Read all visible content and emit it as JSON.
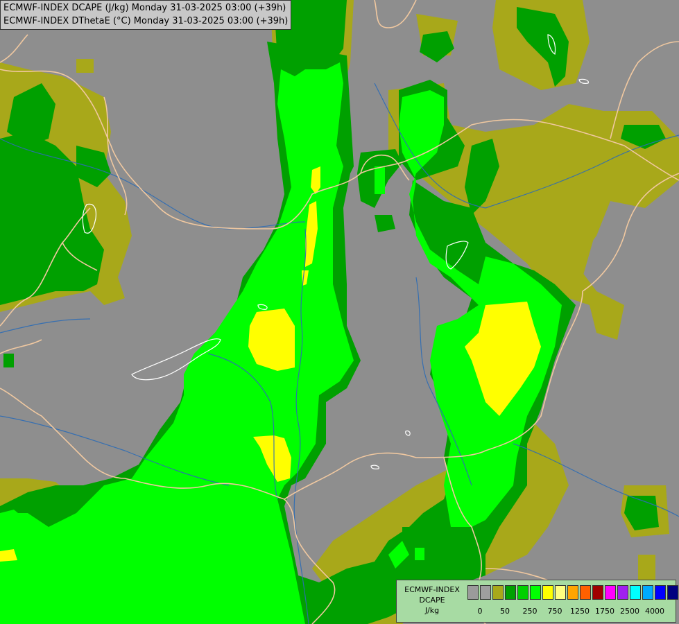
{
  "header": {
    "line1": "ECMWF-INDEX DCAPE (J/kg) Monday 31-03-2025 03:00 (+39h)",
    "line2": "ECMWF-INDEX DThetaE (°C) Monday 31-03-2025 03:00 (+39h)"
  },
  "legend": {
    "model": "ECMWF-INDEX",
    "parameter": "DCAPE",
    "unit": "J/kg",
    "colors": [
      "#9b9b9b",
      "#9f9f9f",
      "#a8a81a",
      "#00a000",
      "#00d000",
      "#00ff00",
      "#ffff00",
      "#ffff80",
      "#ffa500",
      "#ff6000",
      "#a00000",
      "#ff00ff",
      "#a020f0",
      "#00ffff",
      "#00aaff",
      "#0000ff",
      "#000080"
    ],
    "tick_labels": [
      "0",
      "50",
      "250",
      "750",
      "1250",
      "1750",
      "2500",
      "4000"
    ]
  },
  "colors": {
    "background": "#8e8e8e",
    "olive": "#a8a81a",
    "dark_green": "#00a000",
    "green": "#00ff00",
    "yellow": "#ffff00",
    "border_line": "#f0c8a0",
    "river": "#2c6cb5"
  }
}
